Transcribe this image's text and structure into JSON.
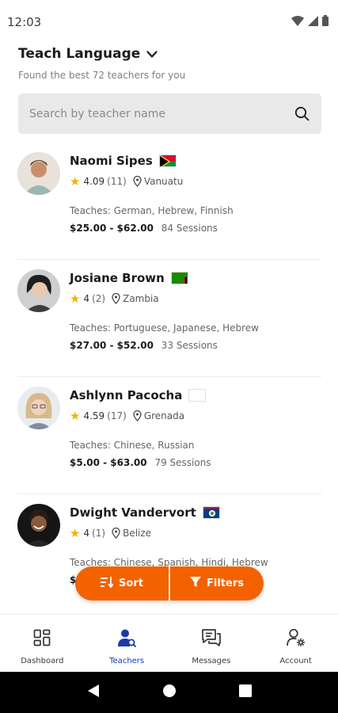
{
  "status_bar": {
    "time": "12:03"
  },
  "header": {
    "title": "Teach Language",
    "subtitle": "Found the best 72 teachers for you"
  },
  "search": {
    "placeholder": "Search by teacher name",
    "value": ""
  },
  "teachers": [
    {
      "name": "Naomi Sipes",
      "flag_icon": "vanuatu-flag-icon",
      "rating": "4.09",
      "reviews": "(11)",
      "location": "Vanuatu",
      "teaches": "Teaches: German, Hebrew, Finnish",
      "price": "$25.00 - $62.00",
      "sessions": "84 Sessions"
    },
    {
      "name": "Josiane Brown",
      "flag_icon": "zambia-flag-icon",
      "rating": "4",
      "reviews": "(2)",
      "location": "Zambia",
      "teaches": "Teaches: Portuguese, Japanese, Hebrew",
      "price": "$27.00 - $52.00",
      "sessions": "33 Sessions"
    },
    {
      "name": "Ashlynn Pacocha",
      "flag_icon": "blank-flag-icon",
      "rating": "4.59",
      "reviews": "(17)",
      "location": "Grenada",
      "teaches": "Teaches: Chinese, Russian",
      "price": "$5.00 - $63.00",
      "sessions": "79 Sessions"
    },
    {
      "name": "Dwight Vandervort",
      "flag_icon": "belize-flag-icon",
      "rating": "4",
      "reviews": "(1)",
      "location": "Belize",
      "teaches": "Teaches: Chinese, Spanish, Hindi, Hebrew",
      "price": "$",
      "sessions": ""
    }
  ],
  "actions": {
    "sort_label": "Sort",
    "filters_label": "Filters"
  },
  "bottom_nav": [
    {
      "label": "Dashboard",
      "icon": "dashboard-icon",
      "active": false
    },
    {
      "label": "Teachers",
      "icon": "teachers-icon",
      "active": true
    },
    {
      "label": "Messages",
      "icon": "messages-icon",
      "active": false
    },
    {
      "label": "Account",
      "icon": "account-icon",
      "active": false
    }
  ],
  "colors": {
    "accent": "#f46200",
    "active_nav": "#1a3aa8",
    "star": "#f5b100",
    "search_bg": "#e9e9e9"
  }
}
